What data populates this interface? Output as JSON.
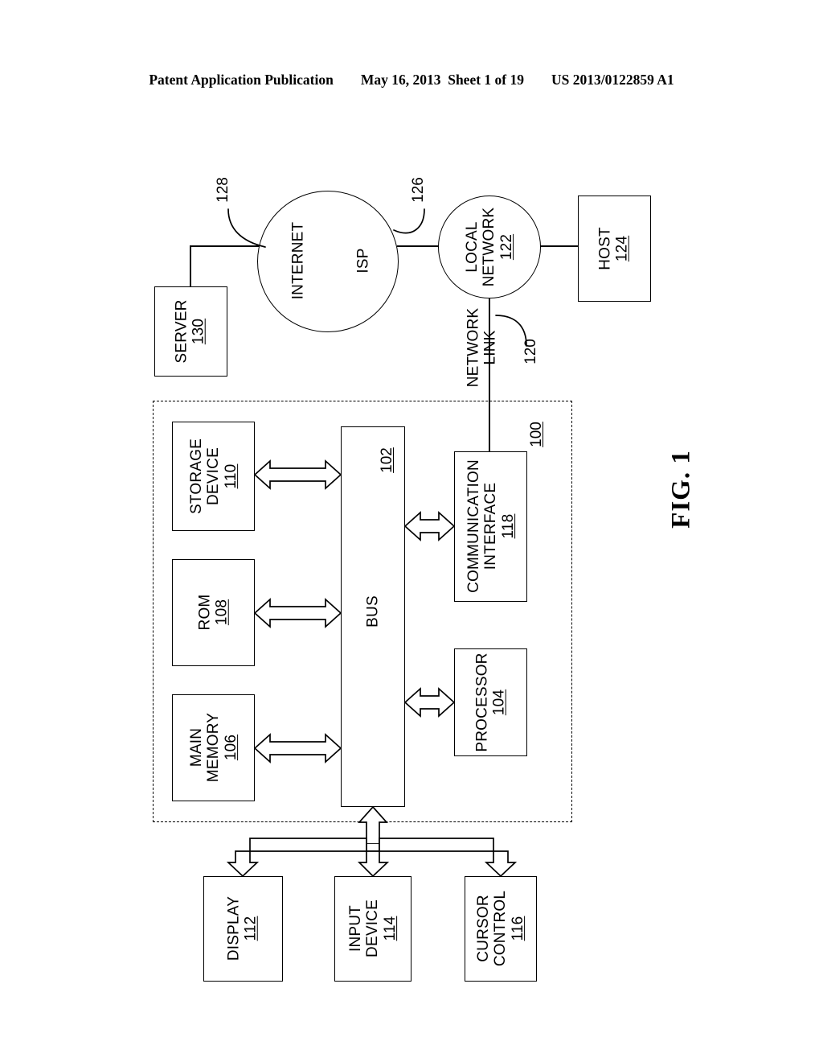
{
  "header": {
    "publication": "Patent Application Publication",
    "date_sheet": "May 16, 2013  Sheet 1 of 19",
    "patent_number": "US 2013/0122859 A1"
  },
  "figure": {
    "label": "FIG. 1",
    "system_ref": "100"
  },
  "nodes": {
    "server": {
      "label": "SERVER",
      "ref": "130"
    },
    "internet": {
      "label": "INTERNET",
      "ref": "128"
    },
    "isp": {
      "label": "ISP",
      "ref": "126"
    },
    "local_network": {
      "label_line1": "LOCAL",
      "label_line2": "NETWORK",
      "ref": "122"
    },
    "host": {
      "label": "HOST",
      "ref": "124"
    },
    "network_link": {
      "label_line1": "NETWORK",
      "label_line2": "LINK",
      "ref": "120"
    },
    "storage_device": {
      "label_line1": "STORAGE",
      "label_line2": "DEVICE",
      "ref": "110"
    },
    "rom": {
      "label": "ROM",
      "ref": "108"
    },
    "main_memory": {
      "label_line1": "MAIN",
      "label_line2": "MEMORY",
      "ref": "106"
    },
    "bus": {
      "label": "BUS",
      "ref": "102"
    },
    "communication_interface": {
      "label_line1": "COMMUNICATION",
      "label_line2": "INTERFACE",
      "ref": "118"
    },
    "processor": {
      "label": "PROCESSOR",
      "ref": "104"
    },
    "display": {
      "label": "DISPLAY",
      "ref": "112"
    },
    "input_device": {
      "label_line1": "INPUT",
      "label_line2": "DEVICE",
      "ref": "114"
    },
    "cursor_control": {
      "label_line1": "CURSOR",
      "label_line2": "CONTROL",
      "ref": "116"
    }
  },
  "colors": {
    "ink": "#000000",
    "paper": "#ffffff"
  }
}
